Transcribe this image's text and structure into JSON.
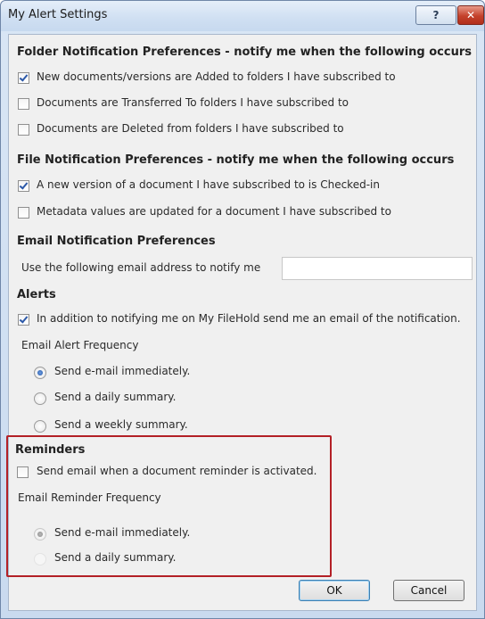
{
  "window": {
    "title": "My Alert Settings"
  },
  "titlebar": {
    "help_label": "?",
    "close_label": "✕"
  },
  "folder": {
    "heading": "Folder Notification Preferences - notify me when the following occurs",
    "options": [
      {
        "label": "New documents/versions are Added to folders I have subscribed to",
        "checked": true
      },
      {
        "label": "Documents are Transferred To  folders I have subscribed to",
        "checked": false
      },
      {
        "label": "Documents are Deleted  from folders I have subscribed to",
        "checked": false
      }
    ]
  },
  "file": {
    "heading": "File Notification Preferences - notify me when the following occurs",
    "options": [
      {
        "label": "A new version of a document I have subscribed to is Checked-in",
        "checked": true
      },
      {
        "label": "Metadata values are updated  for a document I have subscribed to",
        "checked": false
      }
    ]
  },
  "email": {
    "heading": "Email Notification Preferences",
    "address_label": "Use the following email address to notify me",
    "address_value": ""
  },
  "alerts": {
    "heading": "Alerts",
    "notify_label": "In addition to notifying me on My FileHold send me an email of the notification.",
    "notify_checked": true,
    "frequency_label": "Email Alert Frequency",
    "frequency_options": [
      {
        "label": "Send e-mail immediately.",
        "selected": true
      },
      {
        "label": "Send a daily summary.",
        "selected": false
      },
      {
        "label": "Send a weekly summary.",
        "selected": false
      }
    ]
  },
  "reminders": {
    "heading": "Reminders",
    "notify_label": "Send email when a document reminder is activated.",
    "notify_checked": false,
    "frequency_label": "Email Reminder Frequency",
    "frequency_options": [
      {
        "label": "Send e-mail immediately.",
        "selected": true
      },
      {
        "label": "Send a daily summary.",
        "selected": false
      }
    ],
    "highlight_color": "#b32026"
  },
  "buttons": {
    "ok_label": "OK",
    "cancel_label": "Cancel"
  }
}
